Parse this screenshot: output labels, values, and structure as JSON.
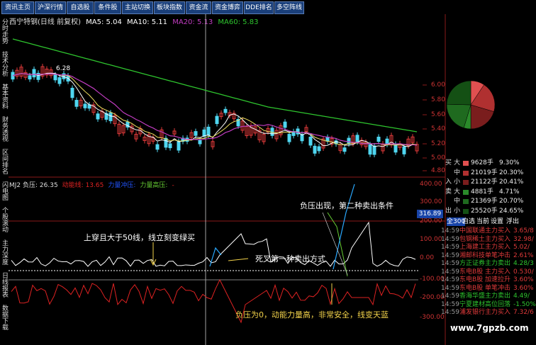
{
  "tabs": [
    "资讯主页",
    "沪深行情",
    "自选股",
    "条件股",
    "主站切换",
    "板块指数",
    "资金流",
    "资金博弈",
    "DDE排名",
    "多空阵线"
  ],
  "vertical_tabs": [
    "分时走势",
    "技术分析",
    "基本资料",
    "财务透视",
    "区间排名",
    "闪电图",
    "个股滚动",
    "主力深度",
    "日线报表",
    "数据下载"
  ],
  "chart_title": "西宁特钢(日线 前复权)",
  "ma": [
    {
      "label": "MA5: 5.04",
      "color": "#ffffff"
    },
    {
      "label": "MA10: 5.11",
      "color": "#ffffff"
    },
    {
      "label": "MA20: 5.13",
      "color": "#c03cc0"
    },
    {
      "label": "MA60: 5.83",
      "color": "#2ec42e"
    }
  ],
  "price_marker": "6.28",
  "price_axis": [
    "6.00",
    "5.80",
    "5.60",
    "5.40",
    "5.20",
    "5.00",
    "4.80"
  ],
  "indicator_legend": [
    {
      "label": "MJ2 负压: 26.35",
      "color": "#dddddd"
    },
    {
      "label": "动能线: 13.65",
      "color": "#dd2222"
    },
    {
      "label": "力量冲压:",
      "color": "#2255ff"
    },
    {
      "label": "力量高压:",
      "color": "#66cc33"
    },
    {
      "label": "-",
      "color": "#dd2222"
    }
  ],
  "indicator_axis": [
    "400.00",
    "300.00",
    "200.00",
    "100.00",
    "0.00",
    "-100.00",
    "-200.00",
    "-300.00"
  ],
  "current_value_tag": "316.89",
  "annotations": {
    "a1": "上穿且大于50线，线立刻变绿买",
    "a2": "负压出现，第二种卖出条件",
    "a3": "死叉第一种卖出方式",
    "a4": "负压为0，动能力量高，非常安全，线变天蓝"
  },
  "pie": {
    "slices": [
      {
        "name": "大买",
        "value": 9.3,
        "color": "#e05050"
      },
      {
        "name": "中买",
        "value": 20.3,
        "color": "#b03030"
      },
      {
        "name": "小买",
        "value": 20.41,
        "color": "#7a1d1d"
      },
      {
        "name": "大卖",
        "value": 4.71,
        "color": "#2a8a2a"
      },
      {
        "name": "中卖",
        "value": 20.7,
        "color": "#1f6a1f"
      },
      {
        "name": "小卖",
        "value": 24.65,
        "color": "#145014"
      }
    ]
  },
  "order_flow": [
    {
      "k": "买",
      "l": "大",
      "v": "9628手",
      "p": "9.30%",
      "color": "#e05050"
    },
    {
      "k": "",
      "l": "中",
      "v": "21019手",
      "p": "20.30%",
      "color": "#b03030"
    },
    {
      "k": "入",
      "l": "小",
      "v": "21122手",
      "p": "20.41%",
      "color": "#7a1d1d"
    },
    {
      "k": "卖",
      "l": "大",
      "v": "4881手",
      "p": "4.71%",
      "color": "#2a8a2a"
    },
    {
      "k": "",
      "l": "中",
      "v": "21369手",
      "p": "20.70%",
      "color": "#1f6a1f"
    },
    {
      "k": "出",
      "l": "小",
      "v": "25520手",
      "p": "24.65%",
      "color": "#145014"
    }
  ],
  "tick_tabs": [
    "全300",
    "自选",
    "当前",
    "设置",
    "浮出"
  ],
  "ticks": [
    {
      "t": "14:59",
      "n": "中国联通",
      "a": "主力买入",
      "v": "3.65/8"
    },
    {
      "t": "14:59",
      "n": "包钢稀土",
      "a": "主力买入",
      "v": "32.98/"
    },
    {
      "t": "14:59",
      "n": "上海建工",
      "a": "主力买入",
      "v": "5.02/"
    },
    {
      "t": "14:59",
      "n": "湘邮科技",
      "a": "单笔冲击",
      "v": "2.61%"
    },
    {
      "t": "14:59",
      "n": "方正证券",
      "a": "主力卖出",
      "v": "4.28/3"
    },
    {
      "t": "14:59",
      "n": "东电B股",
      "a": "主力买入",
      "v": "0.530/"
    },
    {
      "t": "14:59",
      "n": "东电B股",
      "a": "加速拉升",
      "v": "3.60%"
    },
    {
      "t": "14:59",
      "n": "东电B股",
      "a": "单笔冲击",
      "v": "3.60%"
    },
    {
      "t": "14:59",
      "n": "香海华盛",
      "a": "主力卖出",
      "v": "4.49/"
    },
    {
      "t": "14:59",
      "n": "宁夏建材",
      "a": "高位回落",
      "v": "-1.50%"
    },
    {
      "t": "14:59",
      "n": "浦发银行",
      "a": "主力买入",
      "v": "7.32/6"
    }
  ],
  "watermark": "www.7gpzb.com"
}
